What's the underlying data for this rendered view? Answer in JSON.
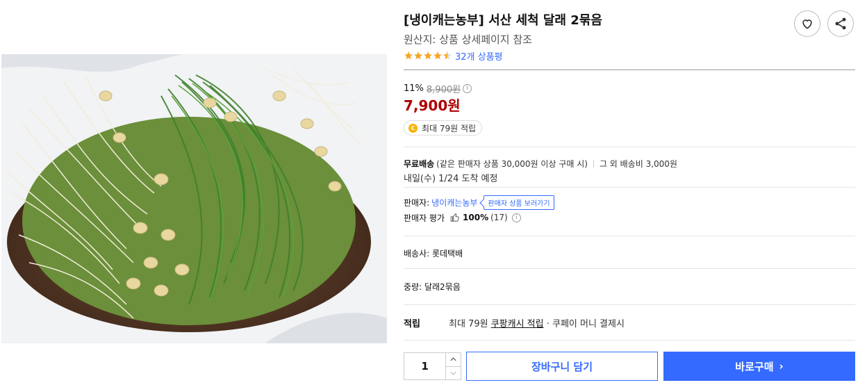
{
  "product": {
    "title": "[냉이캐는농부] 서산 세척 달래 2묶음",
    "origin": "원산지: 상품 상세페이지 참조",
    "rating": 4.5,
    "review_count": "32개 상품평"
  },
  "price": {
    "discount": "11%",
    "original": "8,900원",
    "sale": "7,900원",
    "reward_badge": "최대 79원 적립",
    "coin_label": "C"
  },
  "shipping": {
    "free_label": "무료배송",
    "condition": "(같은 판매자 상품 30,000원 이상 구매 시)",
    "other": "그 외 배송비 3,000원",
    "arrival": "내일(수) 1/24 도착 예정"
  },
  "seller": {
    "label": "판매자:",
    "name": "냉이캐는농부",
    "tip": "판매자 상품 보러가기",
    "rating_label": "판매자 평가",
    "rating_pct": "100%",
    "rating_count": "(17)"
  },
  "details": {
    "carrier": "배송사: 롯데택배",
    "weight": "중량: 달래2묶음"
  },
  "reward": {
    "label": "적립",
    "prefix": "최대 79원 ",
    "link": "쿠팡캐시 적립",
    "suffix": " · 쿠페이 머니 결제시"
  },
  "purchase": {
    "quantity": "1",
    "cart_label": "장바구니 담기",
    "buy_label": "바로구매",
    "buy_chevron": "›"
  },
  "colors": {
    "accent": "#346aff",
    "sale_price": "#ae0000",
    "star": "#f5a623"
  },
  "icons": {
    "heart": "heart-icon",
    "share": "share-icon",
    "info": "info-icon",
    "thumb": "thumbs-up-icon"
  }
}
